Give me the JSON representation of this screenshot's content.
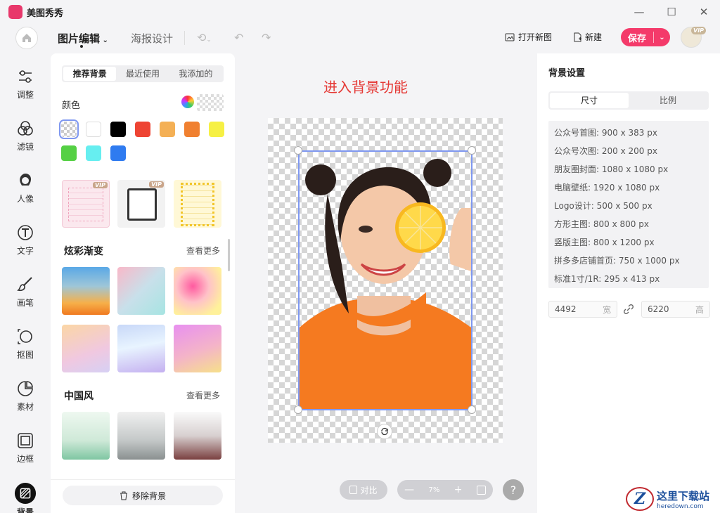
{
  "app": {
    "title": "美图秀秀"
  },
  "window": {
    "minimize": "—",
    "maximize": "☐",
    "close": "✕"
  },
  "toolbar": {
    "tab_image_edit": "图片编辑",
    "tab_poster": "海报设计",
    "open_new": "打开新图",
    "new": "新建",
    "save": "保存",
    "avatar_badge": "VIP"
  },
  "rail": [
    {
      "label": "调整",
      "icon": "sliders-icon"
    },
    {
      "label": "滤镜",
      "icon": "filter-circles-icon"
    },
    {
      "label": "人像",
      "icon": "portrait-icon"
    },
    {
      "label": "文字",
      "icon": "text-icon"
    },
    {
      "label": "画笔",
      "icon": "brush-icon"
    },
    {
      "label": "抠图",
      "icon": "cutout-icon"
    },
    {
      "label": "素材",
      "icon": "sticker-icon"
    },
    {
      "label": "边框",
      "icon": "frame-icon"
    },
    {
      "label": "背景",
      "icon": "background-icon"
    }
  ],
  "left_panel": {
    "tabs": [
      "推荐背景",
      "最近使用",
      "我添加的"
    ],
    "color_label": "颜色",
    "colors": [
      "transparent",
      "#ffffff",
      "#000000",
      "#ee4433",
      "#f4b055",
      "#f08030",
      "#f6f044",
      "#55d044",
      "#66eef0",
      "#2f7bf0"
    ],
    "vip_badge": "VIP",
    "section_gradient": "炫彩渐变",
    "section_chinese": "中国风",
    "see_more": "查看更多",
    "remove_bg": "移除背景"
  },
  "canvas": {
    "label": "进入背景功能"
  },
  "bottom": {
    "compare": "对比",
    "zoom_minus": "—",
    "zoom_value": "7%",
    "zoom_plus": "+",
    "help": "?"
  },
  "right_panel": {
    "title": "背景设置",
    "tabs": [
      "尺寸",
      "比例"
    ],
    "presets": [
      "公众号首图: 900 x 383 px",
      "公众号次图: 200 x 200 px",
      "朋友圈封面: 1080 x 1080 px",
      "电脑壁纸: 1920 x 1080 px",
      "Logo设计: 500 x 500 px",
      "方形主图: 800 x 800 px",
      "竖版主图: 800 x 1200 px",
      "拼多多店铺首页: 750 x 1000 px",
      "标准1寸/1R: 295 x 413 px"
    ],
    "width_value": "4492",
    "width_unit": "宽",
    "height_value": "6220",
    "height_unit": "高"
  },
  "watermark": {
    "title": "这里下载站",
    "url": "heredown.com",
    "logo": "Z"
  }
}
